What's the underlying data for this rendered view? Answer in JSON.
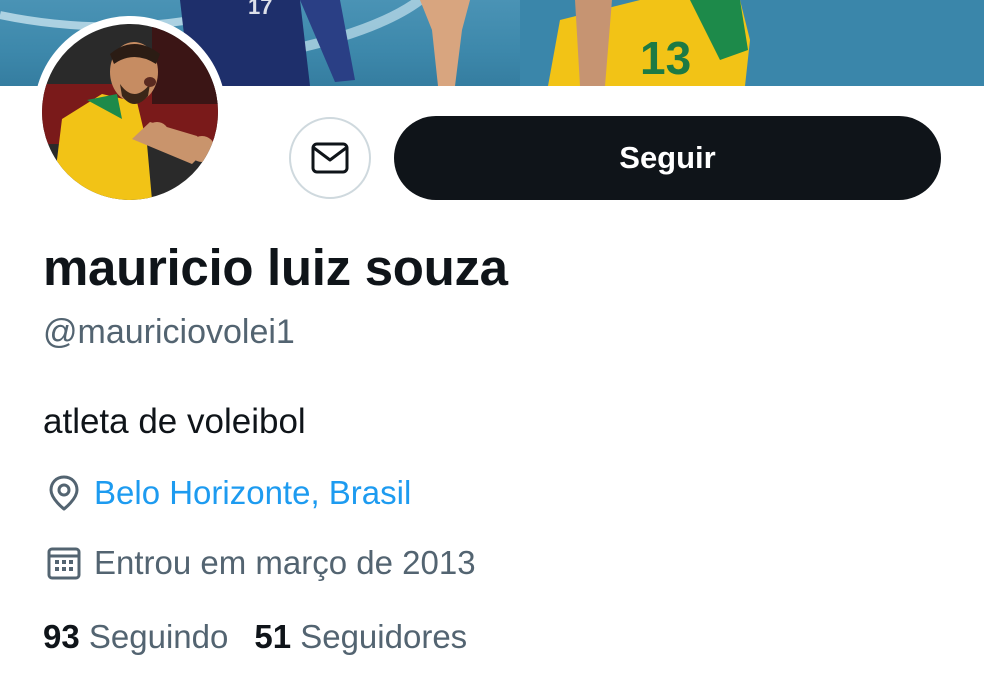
{
  "profile": {
    "name": "mauricio luiz souza",
    "handle": "@mauriciovolei1",
    "bio": "atleta de voleibol",
    "location": "Belo Horizonte, Brasil",
    "joined": "Entrou em março de 2013"
  },
  "actions": {
    "follow_label": "Seguir",
    "message_icon": "envelope-icon"
  },
  "stats": {
    "following_count": "93",
    "following_label": "Seguindo",
    "followers_count": "51",
    "followers_label": "Seguidores"
  },
  "colors": {
    "primary_text": "#0f1419",
    "secondary_text": "#536471",
    "link": "#1d9bf0",
    "button_dark": "#0f1419"
  },
  "icons": {
    "location": "location-pin-icon",
    "joined": "calendar-icon"
  }
}
